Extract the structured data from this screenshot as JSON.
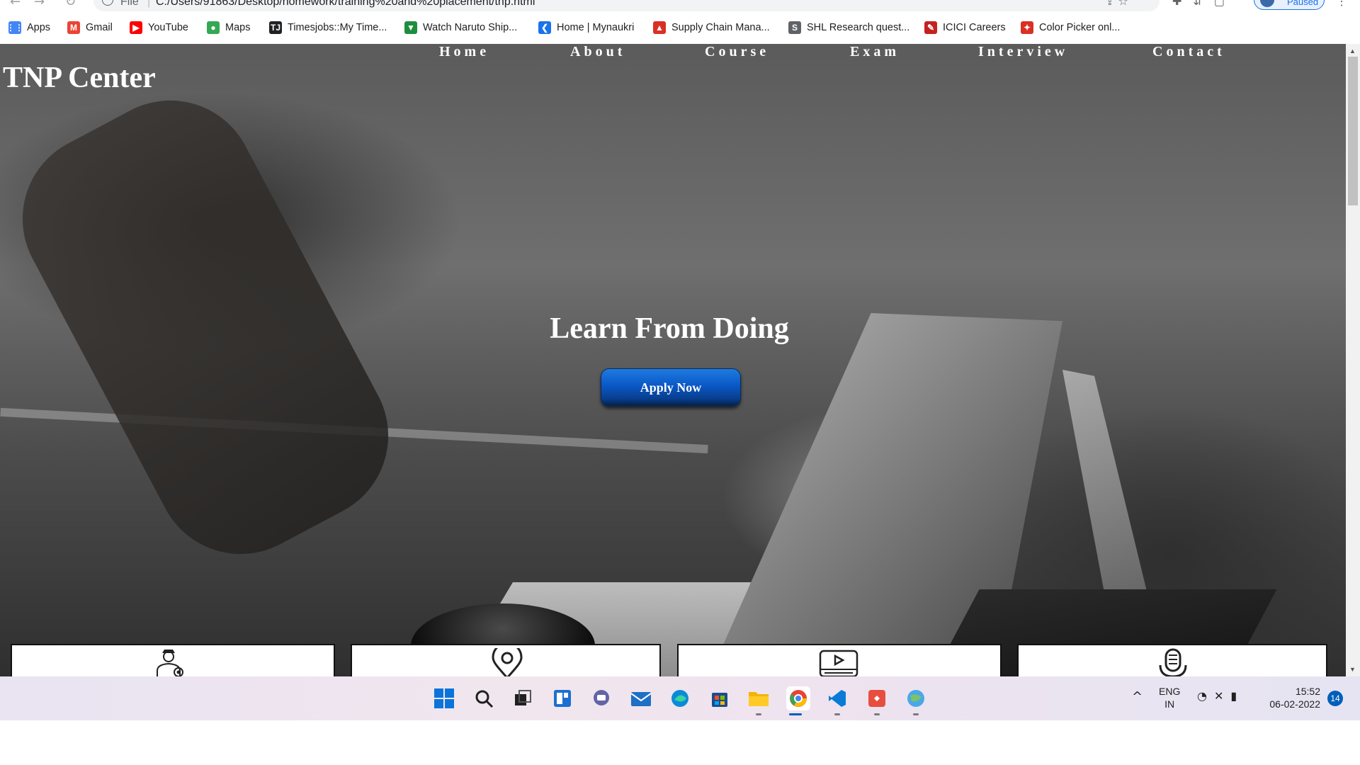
{
  "browser": {
    "url_scheme": "File",
    "url": "C:/Users/91863/Desktop/homework/training%20and%20placement/tnp.html",
    "profile_label": "Paused",
    "bookmarks": [
      {
        "label": "Apps",
        "icon": "apps-grid-icon",
        "color": "#4285f4"
      },
      {
        "label": "Gmail",
        "icon": "gmail-icon",
        "color": "#ea4335"
      },
      {
        "label": "YouTube",
        "icon": "youtube-icon",
        "color": "#ff0000"
      },
      {
        "label": "Maps",
        "icon": "maps-pin-icon",
        "color": "#34a853"
      },
      {
        "label": "Timesjobs::My Time...",
        "icon": "timesjobs-icon",
        "color": "#202124"
      },
      {
        "label": "Watch Naruto Ship...",
        "icon": "naruto-site-icon",
        "color": "#1e8e3e"
      },
      {
        "label": "Home | Mynaukri",
        "icon": "mynaukri-icon",
        "color": "#1a73e8"
      },
      {
        "label": "Supply Chain Mana...",
        "icon": "supply-chain-icon",
        "color": "#d93025"
      },
      {
        "label": "SHL Research quest...",
        "icon": "shl-icon",
        "color": "#5f6368"
      },
      {
        "label": "ICICI Careers",
        "icon": "icici-icon",
        "color": "#c5221f"
      },
      {
        "label": "Color Picker onl...",
        "icon": "color-picker-icon",
        "color": "#d93025"
      }
    ]
  },
  "site": {
    "logo": "TNP Center",
    "nav": [
      "Home",
      "About",
      "Course",
      "Exam",
      "Interview",
      "Contact"
    ],
    "hero_heading": "Learn From Doing",
    "cta_label": "Apply Now",
    "cards": [
      {
        "icon": "officer-icon"
      },
      {
        "icon": "location-pin-icon"
      },
      {
        "icon": "video-player-icon"
      },
      {
        "icon": "microphone-icon"
      }
    ]
  },
  "taskbar": {
    "apps": [
      "windows-start-icon",
      "search-icon",
      "task-view-icon",
      "widgets-icon",
      "teams-chat-icon",
      "mail-icon",
      "edge-icon",
      "store-icon",
      "file-explorer-icon",
      "chrome-icon",
      "vscode-icon",
      "git-gui-icon",
      "network-globe-icon"
    ],
    "lang_line1": "ENG",
    "lang_line2": "IN",
    "time": "15:52",
    "date": "06-02-2022",
    "notification_count": "14"
  }
}
